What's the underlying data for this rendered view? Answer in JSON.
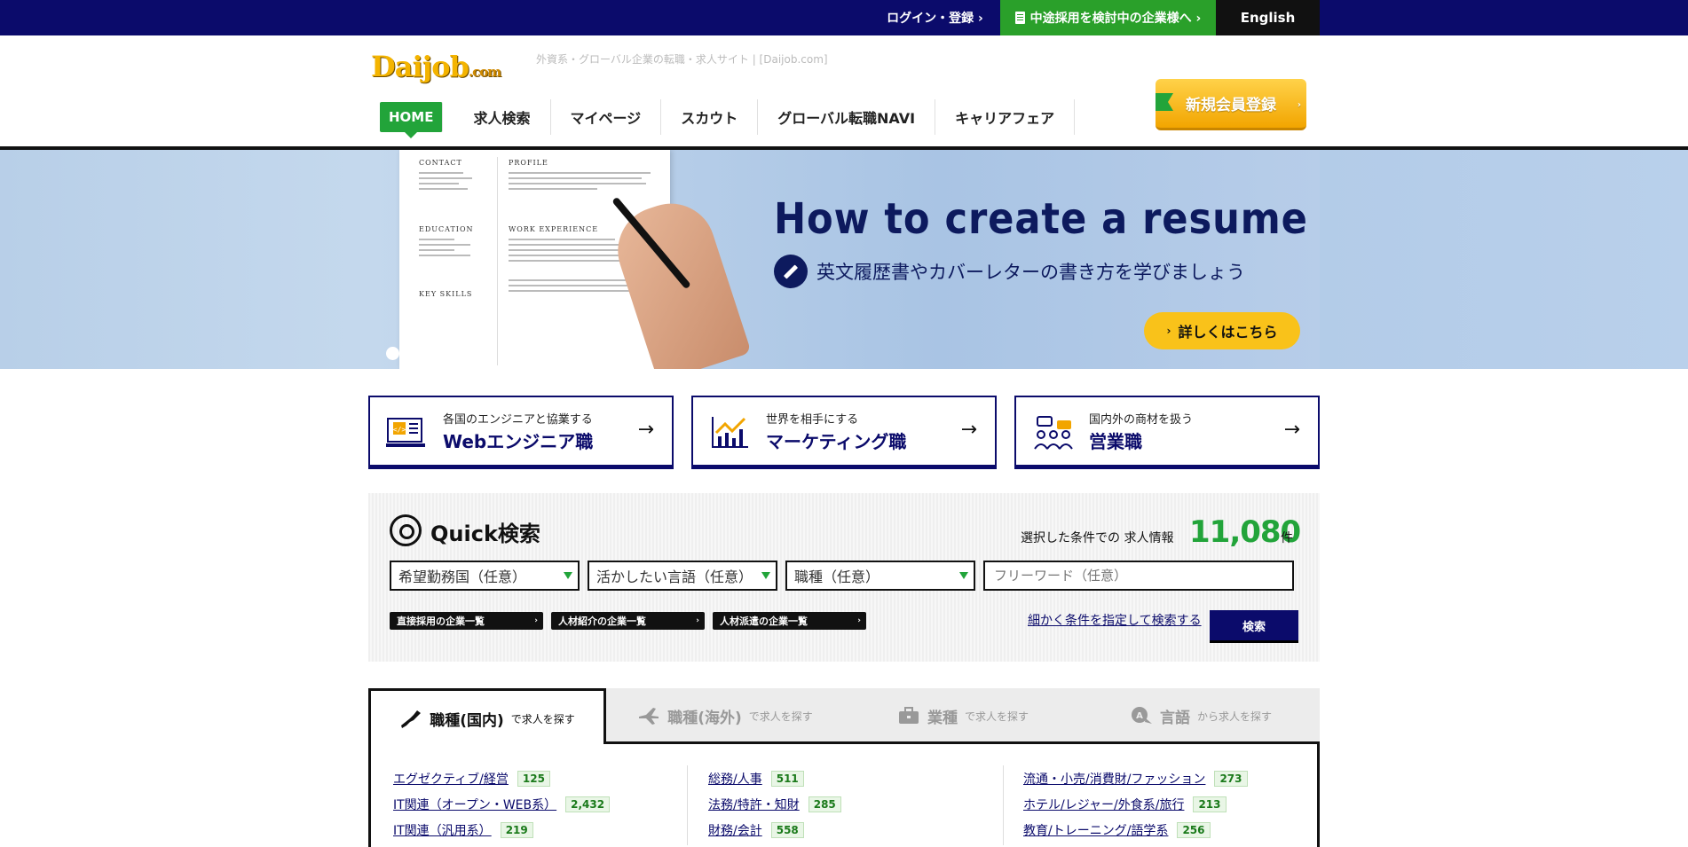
{
  "topbar": {
    "login": "ログイン・登録 ›",
    "employer": "中途採用を検討中の企業様へ ›",
    "english": "English"
  },
  "header": {
    "logo_main": "Daijob",
    "logo_tld": ".com",
    "tagline": "外資系・グローバル企業の転職・求人サイト | [Daijob.com]",
    "nav": [
      "HOME",
      "求人検索",
      "マイページ",
      "スカウト",
      "グローバル転職NAVI",
      "キャリアフェア"
    ],
    "register": "新規会員登録"
  },
  "hero": {
    "title": "How to create a resume",
    "subtitle": "英文履歴書やカバーレターの書き方を学びましょう",
    "button": "詳しくはこちら",
    "resume_headings": [
      "CONTACT",
      "EDUCATION",
      "KEY SKILLS",
      "PROFILE",
      "WORK EXPERIENCE"
    ]
  },
  "cards": [
    {
      "small": "各国のエンジニアと協業する",
      "big": "Webエンジニア職",
      "icon": "web-engineer-icon"
    },
    {
      "small": "世界を相手にする",
      "big": "マーケティング職",
      "icon": "marketing-chart-icon"
    },
    {
      "small": "国内外の商材を扱う",
      "big": "営業職",
      "icon": "sales-people-icon"
    }
  ],
  "quick": {
    "title": "Quick検索",
    "count_label": "選択した条件での 求人情報",
    "count": "11,080",
    "unit": "件",
    "selects": [
      "希望勤務国（任意）",
      "活かしたい言語（任意）",
      "職種（任意）"
    ],
    "freeword_placeholder": "フリーワード（任意）",
    "chips": [
      "直接採用の企業一覧",
      "人材紹介の企業一覧",
      "人材派遣の企業一覧"
    ],
    "detail_link": "細かく条件を指定して検索する",
    "search_button": "検索"
  },
  "tabs": [
    {
      "big": "職種(国内)",
      "small": "で求人を探す",
      "icon": "japan-map-icon"
    },
    {
      "big": "職種(海外)",
      "small": "で求人を探す",
      "icon": "airplane-icon"
    },
    {
      "big": "業種",
      "small": "で求人を探す",
      "icon": "briefcase-icon"
    },
    {
      "big": "言語",
      "small": "から求人を探す",
      "icon": "language-chat-icon"
    }
  ],
  "job_columns": [
    [
      {
        "label": "エグゼクティブ/経営",
        "count": "125"
      },
      {
        "label": "IT関連（オープン・WEB系）",
        "count": "2,432"
      },
      {
        "label": "IT関連（汎用系）",
        "count": "219"
      }
    ],
    [
      {
        "label": "総務/人事",
        "count": "511"
      },
      {
        "label": "法務/特許・知財",
        "count": "285"
      },
      {
        "label": "財務/会計",
        "count": "558"
      }
    ],
    [
      {
        "label": "流通・小売/消費財/ファッション",
        "count": "273"
      },
      {
        "label": "ホテル/レジャー/外食系/旅行",
        "count": "213"
      },
      {
        "label": "教育/トレーニング/語学系",
        "count": "256"
      }
    ]
  ],
  "colors": {
    "navy": "#0b0b6b",
    "green": "#22a43a",
    "yellow": "#f9c21a"
  }
}
